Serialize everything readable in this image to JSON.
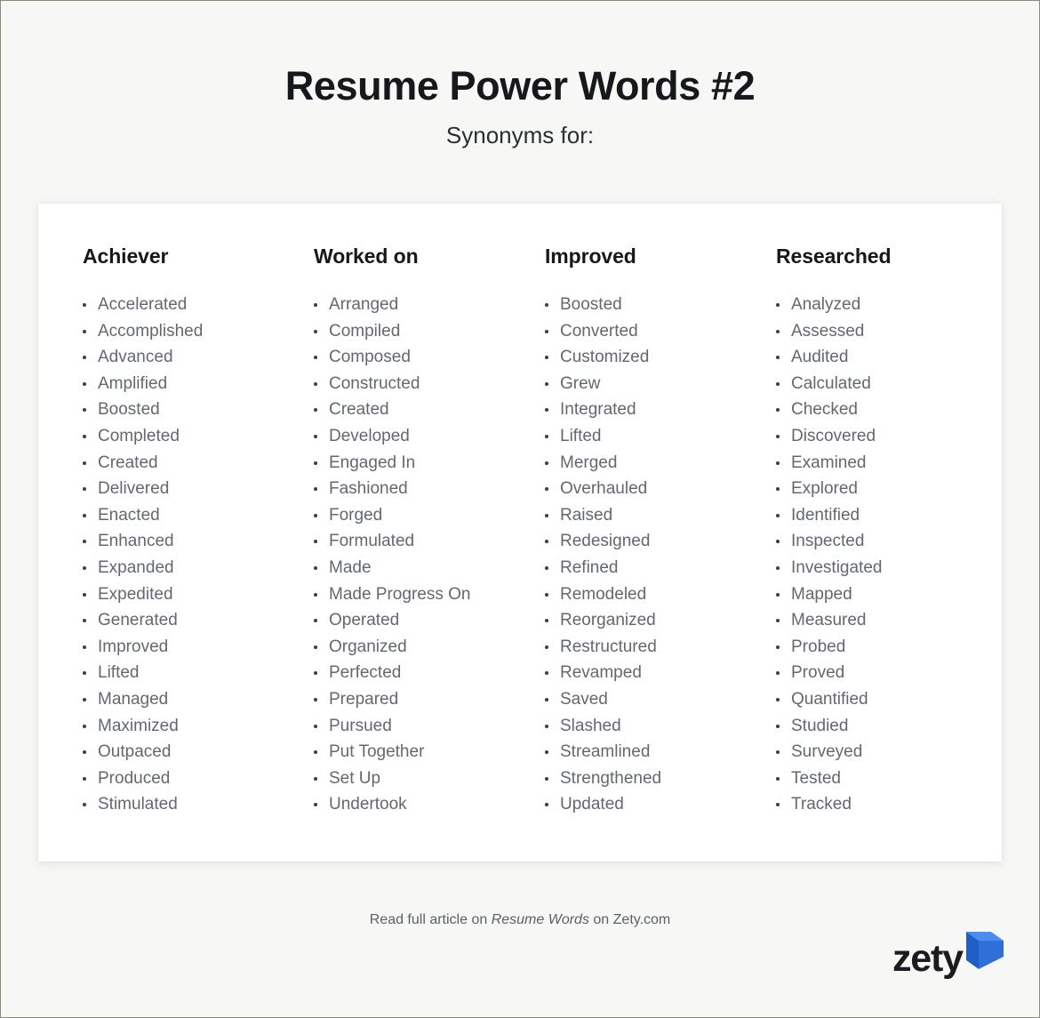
{
  "header": {
    "title": "Resume Power Words #2",
    "subtitle": "Synonyms for:"
  },
  "columns": [
    {
      "title": "Achiever",
      "words": [
        "Accelerated",
        "Accomplished",
        "Advanced",
        "Amplified",
        "Boosted",
        "Completed",
        "Created",
        "Delivered",
        "Enacted",
        "Enhanced",
        "Expanded",
        "Expedited",
        "Generated",
        "Improved",
        "Lifted",
        "Managed",
        "Maximized",
        "Outpaced",
        "Produced",
        "Stimulated"
      ]
    },
    {
      "title": "Worked on",
      "words": [
        "Arranged",
        "Compiled",
        "Composed",
        "Constructed",
        "Created",
        "Developed",
        "Engaged In",
        "Fashioned",
        "Forged",
        "Formulated",
        "Made",
        "Made Progress On",
        "Operated",
        "Organized",
        "Perfected",
        "Prepared",
        "Pursued",
        "Put Together",
        "Set Up",
        "Undertook"
      ]
    },
    {
      "title": "Improved",
      "words": [
        "Boosted",
        "Converted",
        "Customized",
        "Grew",
        "Integrated",
        "Lifted",
        "Merged",
        "Overhauled",
        "Raised",
        "Redesigned",
        "Refined",
        "Remodeled",
        "Reorganized",
        "Restructured",
        "Revamped",
        "Saved",
        "Slashed",
        "Streamlined",
        "Strengthened",
        "Updated"
      ]
    },
    {
      "title": "Researched",
      "words": [
        "Analyzed",
        "Assessed",
        "Audited",
        "Calculated",
        "Checked",
        "Discovered",
        "Examined",
        "Explored",
        "Identified",
        "Inspected",
        "Investigated",
        "Mapped",
        "Measured",
        "Probed",
        "Proved",
        "Quantified",
        "Studied",
        "Surveyed",
        "Tested",
        "Tracked"
      ]
    }
  ],
  "footer": {
    "read_prefix": "Read full article on ",
    "article_name": "Resume Words",
    "read_suffix": " on Zety.com"
  },
  "logo": {
    "wordmark": "zety",
    "mark_icon": "zety-chevron-icon",
    "mark_color_light": "#4a8df0",
    "mark_color_dark": "#1f5fc4"
  },
  "colors": {
    "page_background": "#f7f7f6",
    "card_background": "#ffffff",
    "title_text": "#16181c",
    "word_text": "#636870",
    "bullet": "#3c3f45",
    "footer_text": "#5c6168",
    "frame_border": "#8a8c7a"
  }
}
